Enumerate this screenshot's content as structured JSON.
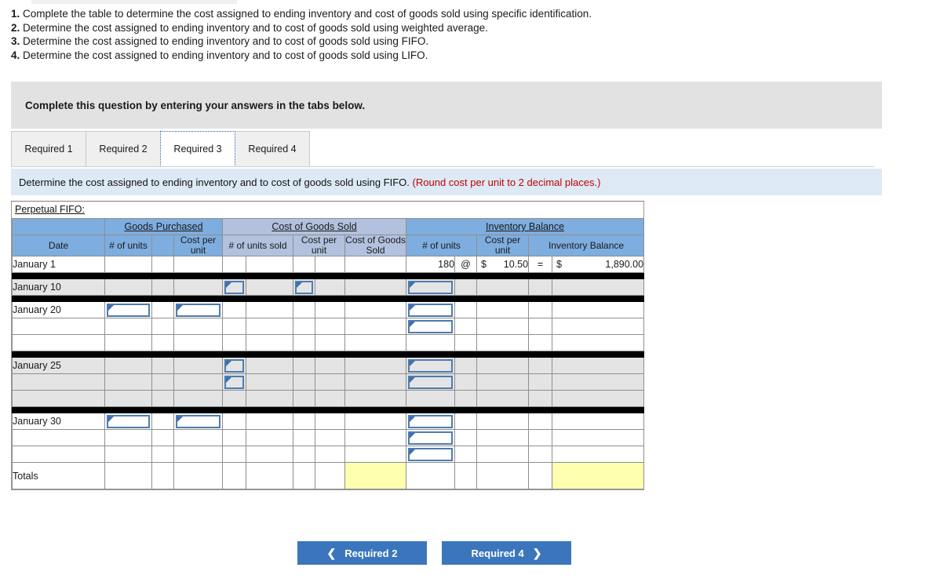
{
  "requirements": [
    {
      "num": "1.",
      "text": "Complete the table to determine the cost assigned to ending inventory and cost of goods sold using specific identification."
    },
    {
      "num": "2.",
      "text": "Determine the cost assigned to ending inventory and to cost of goods sold using weighted average."
    },
    {
      "num": "3.",
      "text": "Determine the cost assigned to ending inventory and to cost of goods sold using FIFO."
    },
    {
      "num": "4.",
      "text": "Determine the cost assigned to ending inventory and to cost of goods sold using LIFO."
    }
  ],
  "grey_banner": {
    "text": "Complete this question by entering your answers in the tabs below."
  },
  "tabs": [
    {
      "label": "Required 1",
      "active": false
    },
    {
      "label": "Required 2",
      "active": false
    },
    {
      "label": "Required 3",
      "active": true
    },
    {
      "label": "Required 4",
      "active": false
    }
  ],
  "question_bar": {
    "text": "Determine the cost assigned to ending inventory and to cost of goods sold using FIFO.",
    "note": "(Round cost per unit to 2 decimal places.)",
    "note_color": "#c00000"
  },
  "worksheet": {
    "title": "Perpetual FIFO:",
    "group_headers": [
      {
        "label": "",
        "colspan": 1
      },
      {
        "label": "Goods Purchased",
        "colspan": 3
      },
      {
        "label": "Cost of Goods Sold",
        "colspan": 5
      },
      {
        "label": "Inventory Balance",
        "colspan": 5
      }
    ],
    "sub_headers": [
      {
        "label": "Date",
        "colspan": 1
      },
      {
        "label": "# of units",
        "colspan": 1
      },
      {
        "label": "",
        "colspan": 1
      },
      {
        "label": "Cost per unit",
        "colspan": 1
      },
      {
        "label": "# of units sold",
        "colspan": 2
      },
      {
        "label": "Cost per unit",
        "colspan": 2
      },
      {
        "label": "Cost of Goods Sold",
        "colspan": 1
      },
      {
        "label": "# of units",
        "colspan": 2
      },
      {
        "label": "Cost per unit",
        "colspan": 1
      },
      {
        "label": "Inventory Balance",
        "colspan": 2
      }
    ],
    "opening_row": {
      "date": "January 1",
      "inv_units": "180",
      "at_symbol": "@",
      "inv_cost_sym": "$",
      "inv_cost": "10.50",
      "equals": "=",
      "inv_bal_sym": "$",
      "inv_balance": "1,890.00"
    },
    "row_groups": [
      {
        "date": "January 10",
        "shaded": true,
        "rows": 1
      },
      {
        "date": "January 20",
        "shaded": false,
        "rows": 3
      },
      {
        "date": "January 25",
        "shaded": true,
        "rows": 3
      },
      {
        "date": "January 30",
        "shaded": false,
        "rows": 3
      }
    ],
    "totals_label": "Totals"
  },
  "nav": {
    "prev_label": "Required 2",
    "prev_icon": "chevron-left-icon",
    "next_label": "Required 4",
    "next_icon": "chevron-right-icon",
    "button_color": "#3b76bd"
  },
  "colors": {
    "header_blue": "#7eaddf",
    "header_mid_blue": "#b2c1de",
    "question_bar_blue": "#ddeaf6",
    "grey_banner": "#e2e2e2",
    "shaded_row": "#e4e4e4",
    "answer_yellow": "#ffffb0",
    "input_border": "#4d7cb0"
  }
}
